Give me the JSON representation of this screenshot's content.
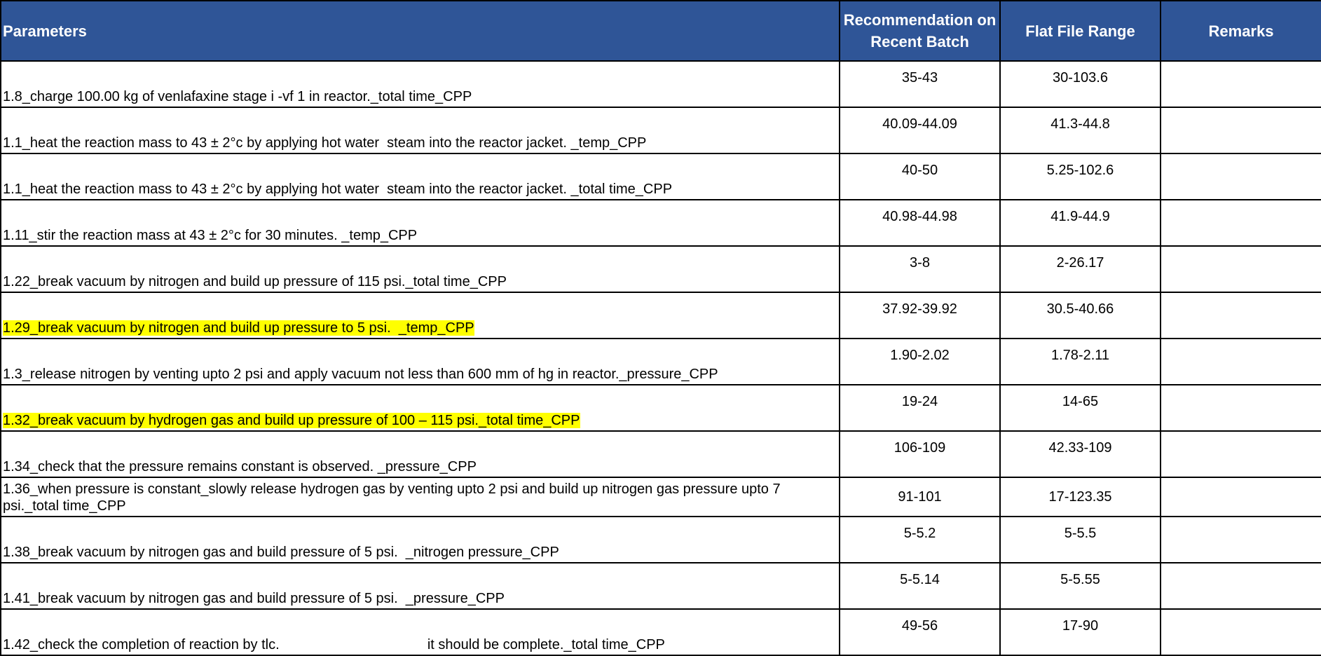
{
  "headers": {
    "parameters": "Parameters",
    "recommendation_line1": "Recommendation on",
    "recommendation_line2": "Recent Batch",
    "flat_file_range": "Flat File Range",
    "remarks": "Remarks"
  },
  "highlight_color": "#ffff00",
  "header_color": "#2f5597",
  "rows": [
    {
      "parameter": "1.8_charge 100.00 kg of venlafaxine stage i -vf 1 in reactor._total time_CPP",
      "recommendation": "35-43",
      "flat_file_range": "30-103.6",
      "remarks": "",
      "highlighted": false
    },
    {
      "parameter": "1.1_heat the reaction mass to 43 ± 2°c by applying hot water  steam into the reactor jacket. _temp_CPP",
      "recommendation": "40.09-44.09",
      "flat_file_range": "41.3-44.8",
      "remarks": "",
      "highlighted": false
    },
    {
      "parameter": "1.1_heat the reaction mass to 43 ± 2°c by applying hot water  steam into the reactor jacket. _total time_CPP",
      "recommendation": "40-50",
      "flat_file_range": "5.25-102.6",
      "remarks": "",
      "highlighted": false
    },
    {
      "parameter": "1.11_stir the reaction mass at 43 ± 2°c for 30 minutes. _temp_CPP",
      "recommendation": "40.98-44.98",
      "flat_file_range": "41.9-44.9",
      "remarks": "",
      "highlighted": false
    },
    {
      "parameter": "1.22_break vacuum by nitrogen and build up pressure of 115 psi._total time_CPP",
      "recommendation": "3-8",
      "flat_file_range": "2-26.17",
      "remarks": "",
      "highlighted": false
    },
    {
      "parameter": "1.29_break vacuum by nitrogen and build up pressure to 5 psi.  _temp_CPP",
      "recommendation": "37.92-39.92",
      "flat_file_range": "30.5-40.66",
      "remarks": "",
      "highlighted": true
    },
    {
      "parameter": "1.3_release nitrogen by venting upto 2 psi and apply vacuum not less than 600 mm of hg in reactor._pressure_CPP",
      "recommendation": "1.90-2.02",
      "flat_file_range": "1.78-2.11",
      "remarks": "",
      "highlighted": false
    },
    {
      "parameter": "1.32_break vacuum by hydrogen gas and build up pressure of 100 – 115 psi._total time_CPP",
      "recommendation": "19-24",
      "flat_file_range": "14-65",
      "remarks": "",
      "highlighted": true
    },
    {
      "parameter": "1.34_check that the pressure remains constant is observed. _pressure_CPP",
      "recommendation": "106-109",
      "flat_file_range": "42.33-109",
      "remarks": "",
      "highlighted": false
    },
    {
      "parameter": "1.36_when pressure is constant_slowly release hydrogen gas by venting upto 2 psi and build up nitrogen gas pressure upto 7 psi._total time_CPP",
      "recommendation": "91-101",
      "flat_file_range": "17-123.35",
      "remarks": "",
      "highlighted": false,
      "tall": true
    },
    {
      "parameter": "1.38_break vacuum by nitrogen gas and build pressure of 5 psi.  _nitrogen pressure_CPP",
      "recommendation": "5-5.2",
      "flat_file_range": "5-5.5",
      "remarks": "",
      "highlighted": false
    },
    {
      "parameter": "1.41_break vacuum by nitrogen gas and build pressure of 5 psi.  _pressure_CPP",
      "recommendation": "5-5.14",
      "flat_file_range": "5-5.55",
      "remarks": "",
      "highlighted": false
    },
    {
      "parameter": "1.42_check the completion of reaction by tlc.                                      it should be complete._total time_CPP",
      "recommendation": "49-56",
      "flat_file_range": "17-90",
      "remarks": "",
      "highlighted": false
    }
  ]
}
